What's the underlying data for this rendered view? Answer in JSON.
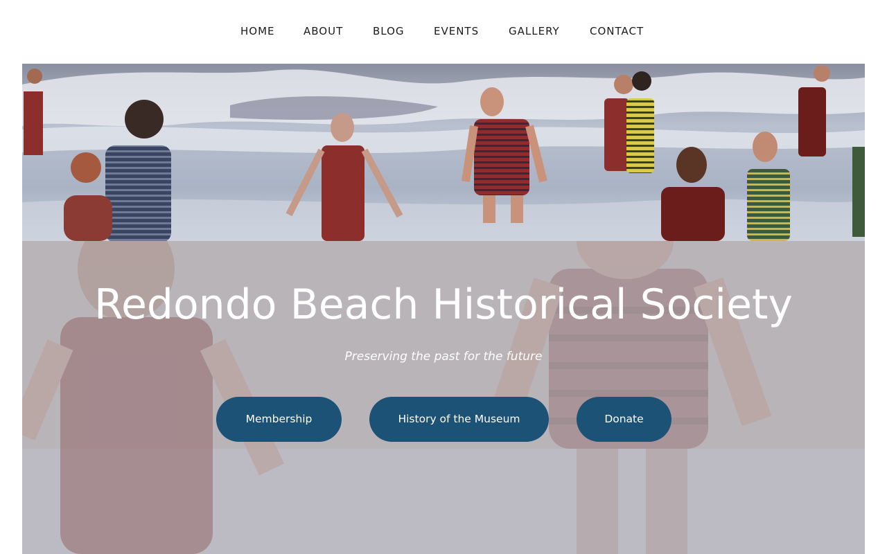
{
  "nav": {
    "items": [
      {
        "label": "HOME"
      },
      {
        "label": "ABOUT"
      },
      {
        "label": "BLOG"
      },
      {
        "label": "EVENTS"
      },
      {
        "label": "GALLERY"
      },
      {
        "label": "CONTACT"
      }
    ]
  },
  "hero": {
    "title": "Redondo Beach Historical Society",
    "tagline": "Preserving the past for the future",
    "buttons": [
      {
        "label": "Membership"
      },
      {
        "label": "History of the Museum"
      },
      {
        "label": "Donate"
      }
    ]
  },
  "colors": {
    "button": "#1c5276",
    "nav_text": "#1a1a1a",
    "hero_text": "#ffffff"
  }
}
